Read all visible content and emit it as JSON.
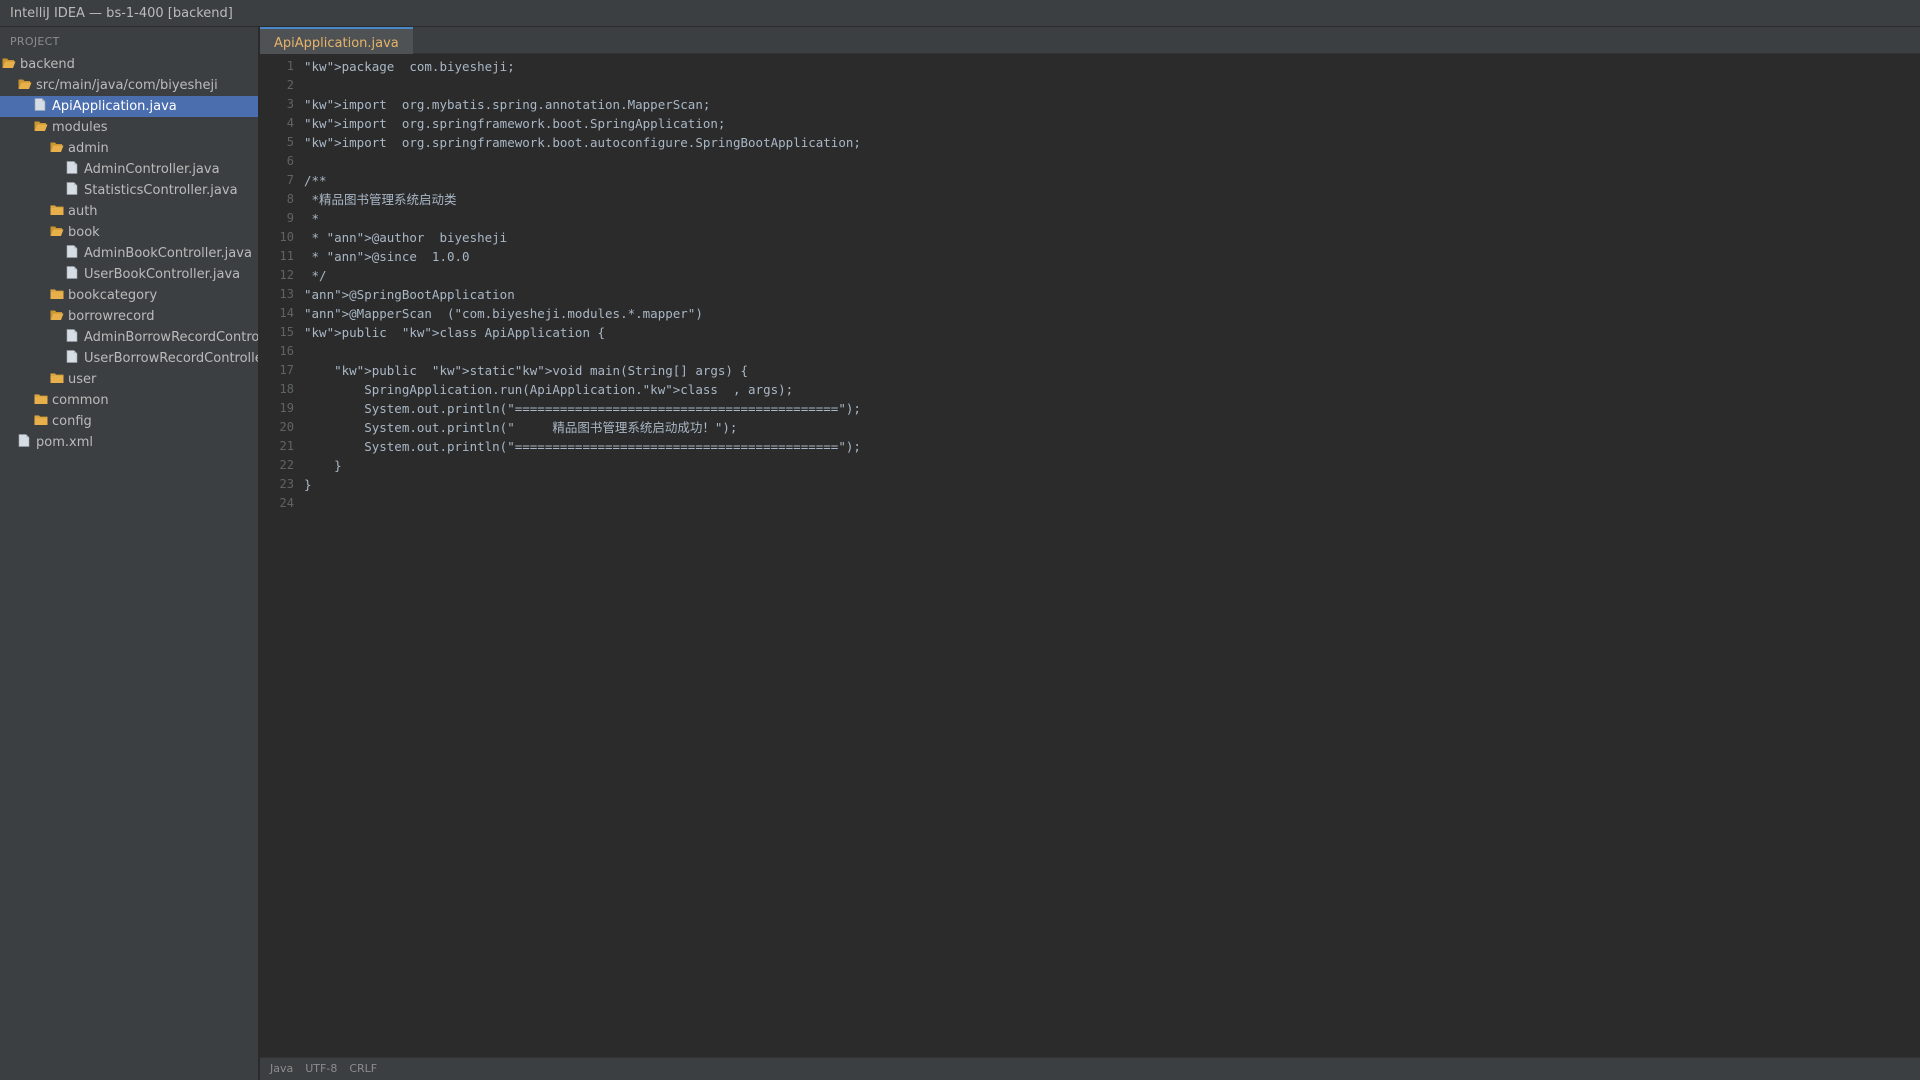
{
  "window": {
    "title": "IntelliJ IDEA — bs-1-400 [backend]"
  },
  "sidebar": {
    "header": "PROJECT",
    "tree": [
      {
        "label": "backend",
        "icon": "folder-open-icon",
        "depth": 0,
        "selected": false
      },
      {
        "label": "src/main/java/com/biyesheji",
        "icon": "folder-open-icon",
        "depth": 1,
        "selected": false
      },
      {
        "label": "ApiApplication.java",
        "icon": "file-icon",
        "depth": 2,
        "selected": true
      },
      {
        "label": "modules",
        "icon": "folder-open-icon",
        "depth": 2,
        "selected": false
      },
      {
        "label": "admin",
        "icon": "folder-open-icon",
        "depth": 3,
        "selected": false
      },
      {
        "label": "AdminController.java",
        "icon": "file-icon",
        "depth": 4,
        "selected": false
      },
      {
        "label": "StatisticsController.java",
        "icon": "file-icon",
        "depth": 4,
        "selected": false
      },
      {
        "label": "auth",
        "icon": "folder-closed-icon",
        "depth": 3,
        "selected": false
      },
      {
        "label": "book",
        "icon": "folder-open-icon",
        "depth": 3,
        "selected": false
      },
      {
        "label": "AdminBookController.java",
        "icon": "file-icon",
        "depth": 4,
        "selected": false
      },
      {
        "label": "UserBookController.java",
        "icon": "file-icon",
        "depth": 4,
        "selected": false
      },
      {
        "label": "bookcategory",
        "icon": "folder-closed-icon",
        "depth": 3,
        "selected": false
      },
      {
        "label": "borrowrecord",
        "icon": "folder-open-icon",
        "depth": 3,
        "selected": false
      },
      {
        "label": "AdminBorrowRecordControl...",
        "icon": "file-icon",
        "depth": 4,
        "selected": false
      },
      {
        "label": "UserBorrowRecordControlle...",
        "icon": "file-icon",
        "depth": 4,
        "selected": false
      },
      {
        "label": "user",
        "icon": "folder-closed-icon",
        "depth": 3,
        "selected": false
      },
      {
        "label": "common",
        "icon": "folder-closed-icon",
        "depth": 2,
        "selected": false
      },
      {
        "label": "config",
        "icon": "folder-closed-icon",
        "depth": 2,
        "selected": false
      },
      {
        "label": "pom.xml",
        "icon": "file-icon",
        "depth": 1,
        "selected": false
      }
    ]
  },
  "editor": {
    "tabs": [
      {
        "label": "ApiApplication.java",
        "active": true
      }
    ],
    "lines": [
      {
        "number": "1",
        "text": "\"kw\">package  com.biyesheji;"
      },
      {
        "number": "2",
        "text": ""
      },
      {
        "number": "3",
        "text": "\"kw\">import  org.mybatis.spring.annotation.MapperScan;"
      },
      {
        "number": "4",
        "text": "\"kw\">import  org.springframework.boot.SpringApplication;"
      },
      {
        "number": "5",
        "text": "\"kw\">import  org.springframework.boot.autoconfigure.SpringBootApplication;"
      },
      {
        "number": "6",
        "text": ""
      },
      {
        "number": "7",
        "text": "/**"
      },
      {
        "number": "8",
        "text": " *精品图书管理系统启动类"
      },
      {
        "number": "9",
        "text": " *"
      },
      {
        "number": "10",
        "text": " * \"ann\">@author  biyesheji"
      },
      {
        "number": "11",
        "text": " * \"ann\">@since  1.0.0"
      },
      {
        "number": "12",
        "text": " */"
      },
      {
        "number": "13",
        "text": "\"ann\">@SpringBootApplication"
      },
      {
        "number": "14",
        "text": "\"ann\">@MapperScan  (\"com.biyesheji.modules.*.mapper\")"
      },
      {
        "number": "15",
        "text": "\"kw\">public  \"kw\">class ApiApplication {"
      },
      {
        "number": "16",
        "text": ""
      },
      {
        "number": "17",
        "text": "    \"kw\">public  \"kw\">static\"kw\">void main(String[] args) {"
      },
      {
        "number": "18",
        "text": "        SpringApplication.run(ApiApplication.\"kw\">class  , args);"
      },
      {
        "number": "19",
        "text": "        System.out.println(\"===========================================\");"
      },
      {
        "number": "20",
        "text": "        System.out.println(\"     精品图书管理系统启动成功！\");"
      },
      {
        "number": "21",
        "text": "        System.out.println(\"===========================================\");"
      },
      {
        "number": "22",
        "text": "    }"
      },
      {
        "number": "23",
        "text": "}"
      },
      {
        "number": "24",
        "text": ""
      }
    ]
  },
  "status_bar": {
    "items": [
      "Java",
      "UTF-8",
      "CRLF"
    ]
  },
  "colors": {
    "selection": "#4b6eaf",
    "folder": "#e8b04a",
    "file": "#d7dde4",
    "active_tab_text": "#e6b36a",
    "code_text": "#a9b7c6",
    "line_number": "#606366"
  }
}
